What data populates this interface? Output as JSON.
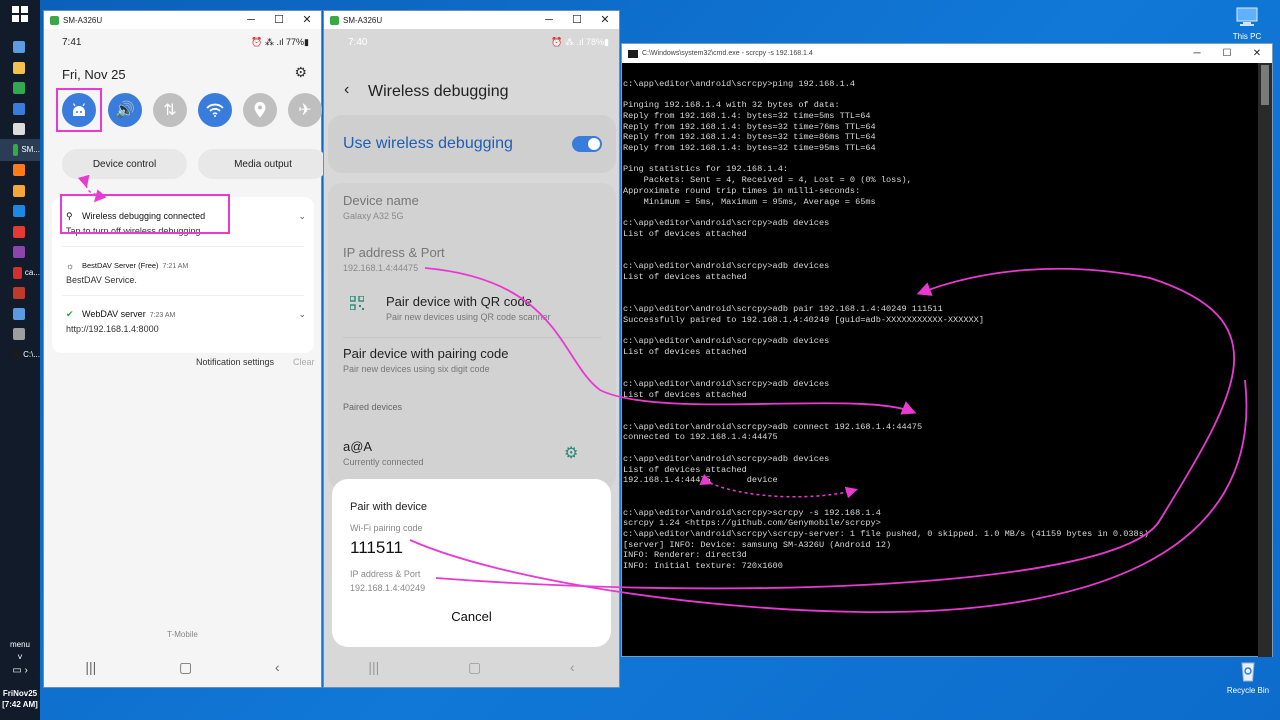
{
  "taskbar": {
    "apps": [
      {
        "name": "app-icon",
        "color": "#5b9be0",
        "label": ""
      },
      {
        "name": "app-icon",
        "color": "#f2c14e",
        "label": ""
      },
      {
        "name": "app-icon",
        "color": "#33a852",
        "label": ""
      },
      {
        "name": "app-icon",
        "color": "#3a7cdb",
        "label": ""
      },
      {
        "name": "app-icon",
        "color": "#dcdcdc",
        "label": ""
      },
      {
        "name": "scrcpy-app",
        "color": "#3aa845",
        "label": "SM..."
      },
      {
        "name": "firefox-icon",
        "color": "#ff7a18",
        "label": ""
      },
      {
        "name": "app-icon",
        "color": "#f4a73b",
        "label": ""
      },
      {
        "name": "app-icon",
        "color": "#1e88e5",
        "label": ""
      },
      {
        "name": "opera-icon",
        "color": "#e53935",
        "label": ""
      },
      {
        "name": "app-icon",
        "color": "#8e44ad",
        "label": ""
      },
      {
        "name": "app-icon",
        "color": "#d32f2f",
        "label": "ca..."
      },
      {
        "name": "app-icon",
        "color": "#c0392b",
        "label": ""
      },
      {
        "name": "app-icon",
        "color": "#5b9be0",
        "label": ""
      },
      {
        "name": "app-icon",
        "color": "#9e9e9e",
        "label": ""
      },
      {
        "name": "cmd-app",
        "color": "#1b1b1b",
        "label": "C:\\..."
      }
    ],
    "menu_label": "menu",
    "clock_date": "FriNov25",
    "clock_time": "[7:42 AM]"
  },
  "phone1": {
    "window_title": "SM-A326U",
    "status_time": "7:41",
    "status_right": "⏰ ⁂ .ıl 77%▮",
    "date": "Fri, Nov 25",
    "pill_left": "Device control",
    "pill_right": "Media output",
    "notif_wd_title": "Wireless debugging connected",
    "notif_wd_sub": "Tap to turn off wireless debugging",
    "notif_bestdav_title": "BestDAV Server (Free)",
    "notif_bestdav_time": "7:21 AM",
    "notif_bestdav_sub": "BestDAV Service.",
    "notif_webdav_title": "WebDAV server",
    "notif_webdav_time": "7:23 AM",
    "notif_webdav_sub": "http://192.168.1.4:8000",
    "notif_settings": "Notification settings",
    "notif_clear": "Clear",
    "carrier": "T-Mobile"
  },
  "phone2": {
    "window_title": "SM-A326U",
    "status_time": "7:40",
    "status_right": "⏰ ⁂ .ıl 78%▮",
    "title": "Wireless debugging",
    "toggle_label": "Use wireless debugging",
    "device_name_label": "Device name",
    "device_name_value": "Galaxy A32 5G",
    "ip_label": "IP address & Port",
    "ip_value": "192.168.1.4:44475",
    "pair_qr_title": "Pair device with QR code",
    "pair_qr_sub": "Pair new devices using QR code scanner",
    "pair_code_title": "Pair device with pairing code",
    "pair_code_sub": "Pair new devices using six digit code",
    "paired_section": "Paired devices",
    "paired_name": "a@A",
    "paired_status": "Currently connected",
    "dialog_title": "Pair with device",
    "dialog_code_label": "Wi-Fi pairing code",
    "dialog_code": "111511",
    "dialog_ip_label": "IP address & Port",
    "dialog_ip": "192.168.1.4:40249",
    "dialog_cancel": "Cancel"
  },
  "cmd": {
    "title": "C:\\Windows\\system32\\cmd.exe - scrcpy  -s 192.168.1.4",
    "lines": [
      "",
      "c:\\app\\editor\\android\\scrcpy>ping 192.168.1.4",
      "",
      "Pinging 192.168.1.4 with 32 bytes of data:",
      "Reply from 192.168.1.4: bytes=32 time=5ms TTL=64",
      "Reply from 192.168.1.4: bytes=32 time=76ms TTL=64",
      "Reply from 192.168.1.4: bytes=32 time=86ms TTL=64",
      "Reply from 192.168.1.4: bytes=32 time=95ms TTL=64",
      "",
      "Ping statistics for 192.168.1.4:",
      "    Packets: Sent = 4, Received = 4, Lost = 0 (0% loss),",
      "Approximate round trip times in milli-seconds:",
      "    Minimum = 5ms, Maximum = 95ms, Average = 65ms",
      "",
      "c:\\app\\editor\\android\\scrcpy>adb devices",
      "List of devices attached",
      "",
      "",
      "c:\\app\\editor\\android\\scrcpy>adb devices",
      "List of devices attached",
      "",
      "",
      "c:\\app\\editor\\android\\scrcpy>adb pair 192.168.1.4:40249 111511",
      "Successfully paired to 192.168.1.4:40249 [guid=adb-XXXXXXXXXXX-XXXXXX]",
      "",
      "c:\\app\\editor\\android\\scrcpy>adb devices",
      "List of devices attached",
      "",
      "",
      "c:\\app\\editor\\android\\scrcpy>adb devices",
      "List of devices attached",
      "",
      "",
      "c:\\app\\editor\\android\\scrcpy>adb connect 192.168.1.4:44475",
      "connected to 192.168.1.4:44475",
      "",
      "c:\\app\\editor\\android\\scrcpy>adb devices",
      "List of devices attached",
      "192.168.1.4:44475       device",
      "",
      "",
      "c:\\app\\editor\\android\\scrcpy>scrcpy -s 192.168.1.4",
      "scrcpy 1.24 <https://github.com/Genymobile/scrcpy>",
      "c:\\app\\editor\\android\\scrcpy\\scrcpy-server: 1 file pushed, 0 skipped. 1.0 MB/s (41159 bytes in 0.038s)",
      "[server] INFO: Device: samsung SM-A326U (Android 12)",
      "INFO: Renderer: direct3d",
      "INFO: Initial texture: 720x1600"
    ]
  },
  "desktop": {
    "this_pc": "This PC",
    "recycle_bin": "Recycle Bin"
  },
  "colors": {
    "accent_blue": "#3a7cdb",
    "annotation_magenta": "#e83ad1",
    "desktop_blue": "#0b5fb8"
  }
}
